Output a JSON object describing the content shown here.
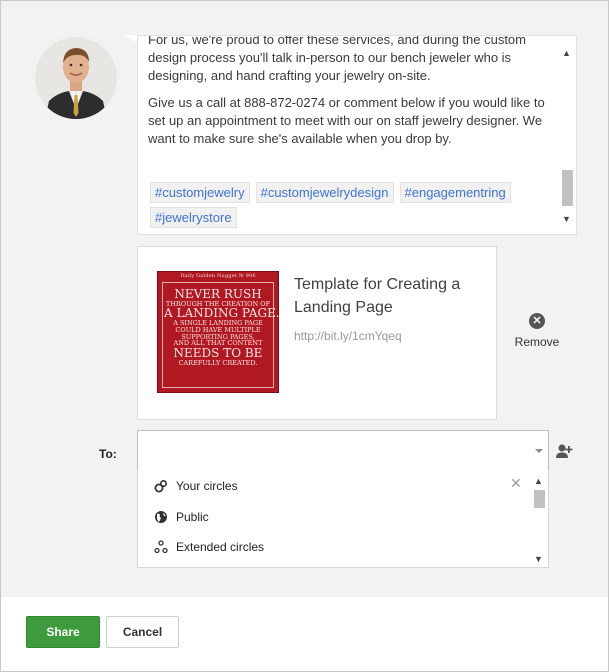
{
  "post": {
    "paragraphs": [
      "For us, we're proud to offer these services, and during the custom design process you'll talk in-person to our bench jeweler who is designing, and hand crafting your jewelry on-site.",
      "Give us a call at 888-872-0274 or comment below if you would like to set up an appointment to meet with our on staff jewelry designer. We want to make sure she's available when you drop by."
    ],
    "tags": [
      "#customjewelry",
      "#customjewelrydesign",
      "#engagementring",
      "#jewelrystore"
    ]
  },
  "link_preview": {
    "title": "Template for Creating a Landing Page",
    "url": "http://bit.ly/1cmYqeq",
    "thumbnail_header": "Daily Golden Nugget № 906",
    "thumbnail_lines": [
      "Never Rush",
      "through the creation of",
      "a landing page.",
      "A single landing page",
      "could have multiple",
      "supporting pages,",
      "and all that content",
      "needs to be",
      "carefully created."
    ],
    "remove_label": "Remove"
  },
  "share_to": {
    "label": "To:",
    "input_value": "",
    "options": [
      "Your circles",
      "Public",
      "Extended circles"
    ]
  },
  "footer": {
    "share_label": "Share",
    "cancel_label": "Cancel"
  },
  "colors": {
    "share_green": "#3d9a3d",
    "tag_blue": "#3f73d4",
    "thumbnail_red": "#b01822"
  }
}
